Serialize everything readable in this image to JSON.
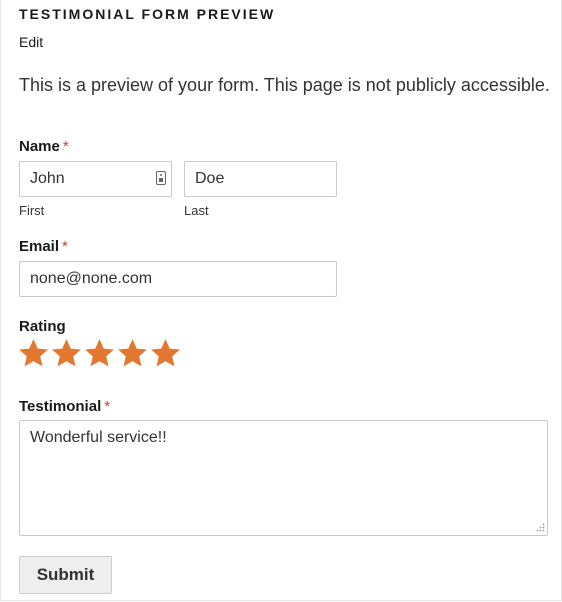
{
  "page": {
    "title": "TESTIMONIAL FORM PREVIEW",
    "edit_label": "Edit",
    "notice": "This is a preview of your form. This page is not publicly accessible."
  },
  "form": {
    "name": {
      "label": "Name",
      "required_mark": "*",
      "first_value": "John",
      "first_sublabel": "First",
      "last_value": "Doe",
      "last_sublabel": "Last"
    },
    "email": {
      "label": "Email",
      "required_mark": "*",
      "value": "none@none.com"
    },
    "rating": {
      "label": "Rating",
      "value": 5,
      "max": 5,
      "star_color": "#e27730"
    },
    "testimonial": {
      "label": "Testimonial",
      "required_mark": "*",
      "value": "Wonderful service!!"
    },
    "submit_label": "Submit"
  },
  "icons": {
    "autofill": "contact-card-icon",
    "star": "star-icon",
    "resize": "resize-grip-icon"
  },
  "colors": {
    "required": "#d63638",
    "star": "#e27730",
    "button_bg": "#eeeeee",
    "border": "#c8c8c8"
  }
}
